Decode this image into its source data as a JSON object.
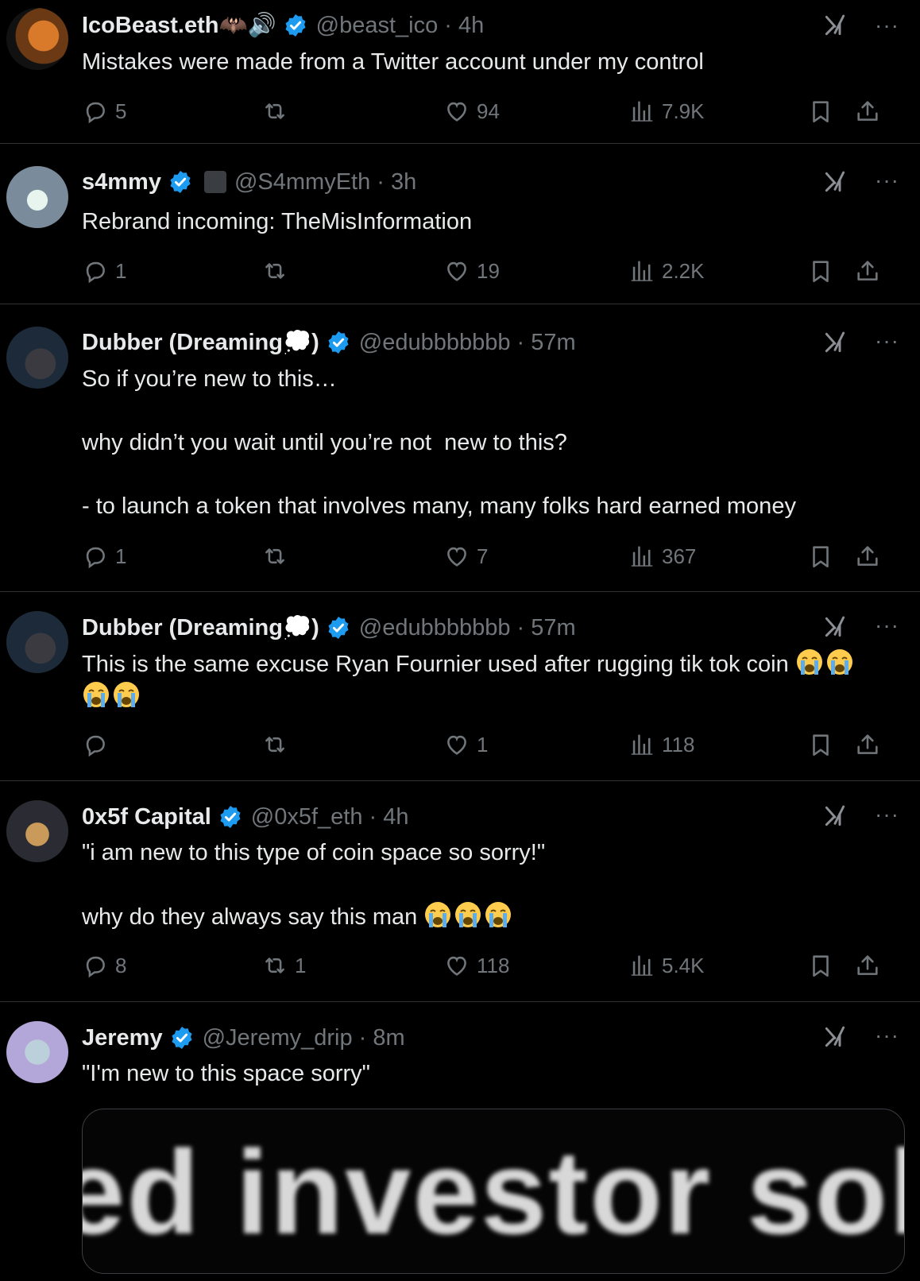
{
  "tweets": [
    {
      "name": "IcoBeast.eth🦇🔊",
      "handle": "@beast_ico · 4h",
      "text": "Mistakes were made from a Twitter account under my control",
      "replies": "5",
      "reposts": "",
      "likes": "94",
      "views": "7.9K"
    },
    {
      "name": "s4mmy",
      "handle": "@S4mmyEth · 3h",
      "text": "Rebrand incoming: TheMisInformation",
      "replies": "1",
      "reposts": "",
      "likes": "19",
      "views": "2.2K"
    },
    {
      "name": "Dubber (Dreaming💭)",
      "handle": "@edubbbbbbb · 57m",
      "text": "So if you’re new to this…\n\nwhy didn’t you wait until you’re not  new to this?\n\n- to launch a token that involves many, many folks hard earned money",
      "replies": "1",
      "reposts": "",
      "likes": "7",
      "views": "367"
    },
    {
      "name": "Dubber (Dreaming💭)",
      "handle": "@edubbbbbbb · 57m",
      "text": "This is the same excuse Ryan Fournier used after rugging tik tok coin",
      "replies": "",
      "reposts": "",
      "likes": "1",
      "views": "118"
    },
    {
      "name": "0x5f Capital",
      "handle": "@0x5f_eth · 4h",
      "text": "\"i am new to this type of coin space so sorry!\"\n\nwhy do they always say this man",
      "replies": "8",
      "reposts": "1",
      "likes": "118",
      "views": "5.4K"
    },
    {
      "name": "Jeremy",
      "handle": "@Jeremy_drip · 8m",
      "text": "\"I'm new to this space sorry\"",
      "media_text": "ed investor sola"
    }
  ],
  "icons": {
    "reply": "reply-icon",
    "repost": "repost-icon",
    "like": "heart-icon",
    "views": "views-icon",
    "bookmark": "bookmark-icon",
    "share": "share-icon",
    "more": "more-icon",
    "grok": "grok-icon",
    "verified": "verified-badge-icon"
  },
  "colors": {
    "background": "#000000",
    "text": "#e7e9ea",
    "muted": "#71767b",
    "verified": "#1d9bf0",
    "divider": "#2f3336"
  },
  "more_glyph": "···"
}
